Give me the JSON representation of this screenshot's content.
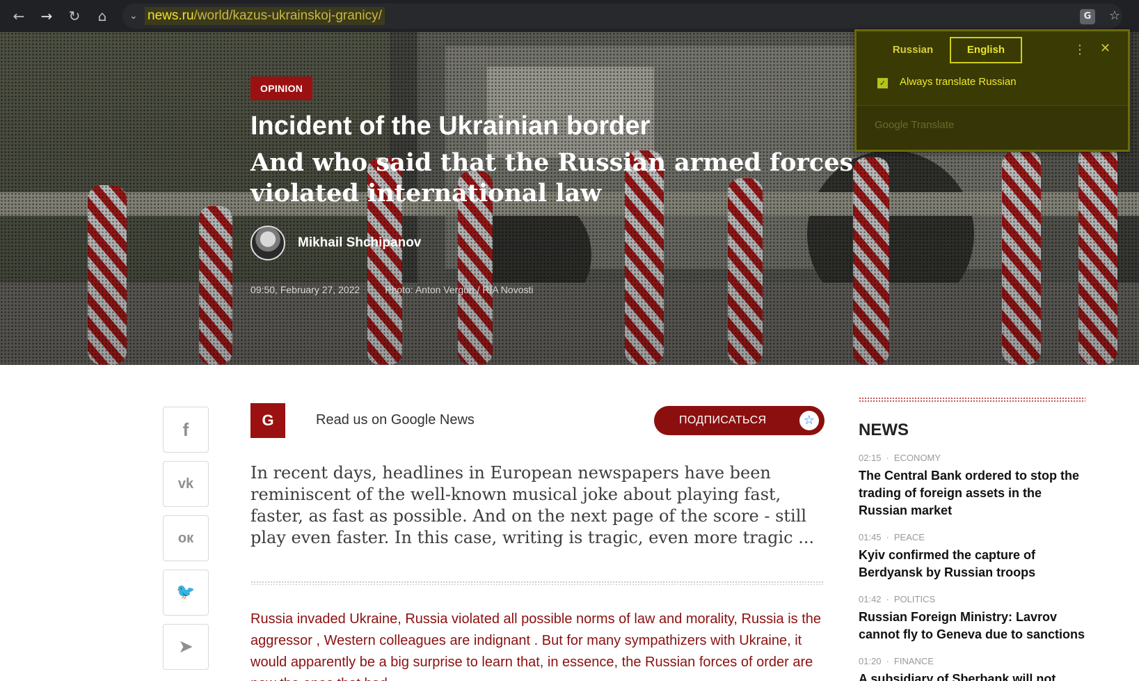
{
  "browser": {
    "url_host": "news.ru",
    "url_path": "/world/kazus-ukrainskoj-granicy/",
    "icons": [
      "back-arrow-icon",
      "forward-arrow-icon",
      "reload-icon",
      "home-icon",
      "chevron-down-icon",
      "translate-icon",
      "star-icon"
    ],
    "glyphs": {
      "back": "←",
      "forward": "→",
      "reload": "↻",
      "home": "⌂",
      "chevron": "⌄",
      "translate": "G",
      "star": "☆"
    }
  },
  "translate_popup": {
    "tab_source": "Russian",
    "tab_target": "English",
    "always_translate_label": "Always translate Russian",
    "always_translate_checked": true,
    "brand": "Google Translate",
    "more_glyph": "⋮",
    "close_glyph": "✕",
    "check_glyph": "✓"
  },
  "hero": {
    "badge": "OPINION",
    "title": "Incident of the Ukrainian border",
    "subtitle": "And who said that the Russian armed forces violated international law",
    "author": "Mikhail Shchipanov",
    "timestamp": "09:50, February 27, 2022",
    "photo_credit": "Photo: Anton Vergun / RIA Novosti"
  },
  "social": {
    "buttons": [
      {
        "name": "facebook-icon",
        "glyph": "f"
      },
      {
        "name": "vk-icon",
        "glyph": "vk"
      },
      {
        "name": "odnoklassniki-icon",
        "glyph": "ок"
      },
      {
        "name": "twitter-icon",
        "glyph": "🐦"
      },
      {
        "name": "telegram-icon",
        "glyph": "➤"
      }
    ]
  },
  "gnews": {
    "logo_letter": "G",
    "label": "Read us on Google News",
    "subscribe_label": "ПОДПИСАТЬСЯ",
    "star_glyph": "☆"
  },
  "article": {
    "lead": "In recent days, headlines in European newspapers have been reminiscent of the well-known musical joke about playing fast, faster, as fast as possible. And on the next page of the score - still play even faster. In this case, writing is tragic, even more tragic ...",
    "body": "Russia invaded Ukraine, Russia violated all possible norms of law and morality, Russia is the aggressor , Western colleagues are indignant . But for many sympathizers with Ukraine, it would apparently be a big surprise to learn that, in essence, the Russian forces of order are now the ones that had"
  },
  "news": {
    "heading": "NEWS",
    "items": [
      {
        "time": "02:15",
        "category": "ECONOMY",
        "title": "The Central Bank ordered to stop the trading of foreign assets in the Russian market"
      },
      {
        "time": "01:45",
        "category": "PEACE",
        "title": "Kyiv confirmed the capture of Berdyansk by Russian troops"
      },
      {
        "time": "01:42",
        "category": "POLITICS",
        "title": "Russian Foreign Ministry: Lavrov cannot fly to Geneva due to sanctions"
      },
      {
        "time": "01:20",
        "category": "FINANCE",
        "title": "A subsidiary of Sberbank will not"
      }
    ]
  },
  "colors": {
    "accent": "#9b1010",
    "browser_bg": "#202124",
    "popup_bg": "#3a3a05",
    "body_link": "#8c1010"
  }
}
